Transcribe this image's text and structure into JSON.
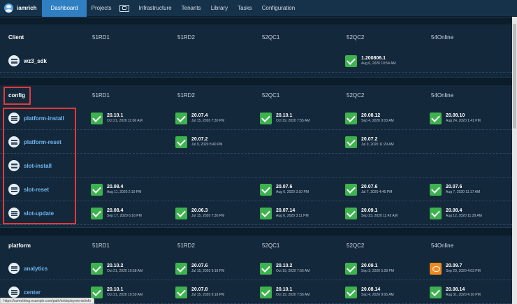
{
  "nav": {
    "user": "iamrich",
    "items": [
      {
        "label": "Dashboard",
        "active": true
      },
      {
        "label": "Projects",
        "active": false
      },
      {
        "label": "Infrastructure",
        "active": false
      },
      {
        "label": "Tenants",
        "active": false
      },
      {
        "label": "Library",
        "active": false
      },
      {
        "label": "Tasks",
        "active": false
      },
      {
        "label": "Configuration",
        "active": false
      }
    ]
  },
  "columns": [
    "51RD1",
    "51RD2",
    "52QC1",
    "52QC2",
    "54Online"
  ],
  "sections": [
    {
      "name": "Client",
      "rows": [
        {
          "name": "wz3_sdk",
          "cells": [
            null,
            null,
            null,
            {
              "version": "1.200806.1",
              "date": "Aug 6, 2020 10:54 AM",
              "status": "ok"
            },
            null
          ]
        }
      ]
    },
    {
      "name": "config",
      "rows": [
        {
          "name": "platform-install",
          "cells": [
            {
              "version": "20.10.1",
              "date": "Oct 21, 2020 11:06 AM",
              "status": "ok"
            },
            {
              "version": "20.07.4",
              "date": "Jul 15, 2020 7:30 PM",
              "status": "ok"
            },
            {
              "version": "20.10.1",
              "date": "Oct 19, 2020 7:55 AM",
              "status": "ok"
            },
            {
              "version": "20.08.12",
              "date": "Sep 4, 2020 9:03 AM",
              "status": "ok"
            },
            {
              "version": "20.08.10",
              "date": "Aug 24, 2020 1:41 PM",
              "status": "ok"
            }
          ]
        },
        {
          "name": "platform-reset",
          "cells": [
            null,
            {
              "version": "20.07.2",
              "date": "Jul 9, 2020 8:40 PM",
              "status": "ok"
            },
            null,
            {
              "version": "20.07.2",
              "date": "Jul 9, 2020 11:29 AM",
              "status": "ok"
            },
            null
          ]
        },
        {
          "name": "slot-install",
          "cells": [
            null,
            null,
            null,
            null,
            null
          ]
        },
        {
          "name": "slot-reset",
          "cells": [
            {
              "version": "20.08.4",
              "date": "Aug 11, 2020 2:19 PM",
              "status": "ok"
            },
            null,
            {
              "version": "20.07.6",
              "date": "Aug 6, 2020 3:10 PM",
              "status": "ok"
            },
            {
              "version": "20.07.6",
              "date": "Jul 7, 2020 4:45 PM",
              "status": "ok"
            },
            {
              "version": "20.07.6",
              "date": "Aug 7, 2020 11:17 AM",
              "status": "ok"
            }
          ]
        },
        {
          "name": "slot-update",
          "cells": [
            {
              "version": "20.08.4",
              "date": "Sep 17, 2020 6:16 PM",
              "status": "ok"
            },
            {
              "version": "20.06.3",
              "date": "Jul 15, 2020 7:30 PM",
              "status": "ok"
            },
            {
              "version": "20.07.14",
              "date": "Aug 6, 2020 3:11 PM",
              "status": "ok"
            },
            {
              "version": "20.09.1",
              "date": "Sep 23, 2020 11:42 AM",
              "status": "ok"
            },
            {
              "version": "20.08.4",
              "date": "Aug 12, 2020 11:29 AM",
              "status": "ok"
            }
          ]
        }
      ]
    },
    {
      "name": "platform",
      "rows": [
        {
          "name": "analytics",
          "cells": [
            {
              "version": "20.10.2",
              "date": "Oct 21, 2020 10:58 AM",
              "status": "ok"
            },
            {
              "version": "20.07.6",
              "date": "Jul 15, 2020 9:18 PM",
              "status": "ok"
            },
            {
              "version": "20.10.2",
              "date": "Oct 19, 2020 7:56 AM",
              "status": "ok"
            },
            {
              "version": "20.09.1",
              "date": "Sep 3, 2020 5:28 PM",
              "status": "ok"
            },
            {
              "version": "20.09.7",
              "date": "Sep 29, 2020 4:03 PM",
              "status": "warn"
            }
          ]
        },
        {
          "name": "center",
          "cells": [
            {
              "version": "20.10.1",
              "date": "Oct 21, 2020 10:59 AM",
              "status": "ok"
            },
            {
              "version": "20.07.8",
              "date": "Jul 15, 2020 9:18 PM",
              "status": "ok"
            },
            {
              "version": "20.10.1",
              "date": "Oct 19, 2020 7:56 AM",
              "status": "ok"
            },
            {
              "version": "20.08.14",
              "date": "Sep 4, 2020 9:05 AM",
              "status": "ok"
            },
            {
              "version": "20.08.14",
              "date": "Aug 31, 2020 4:16 PM",
              "status": "ok"
            }
          ]
        }
      ]
    }
  ],
  "status_url": "https://something.example.com/path/to/deployments/info"
}
